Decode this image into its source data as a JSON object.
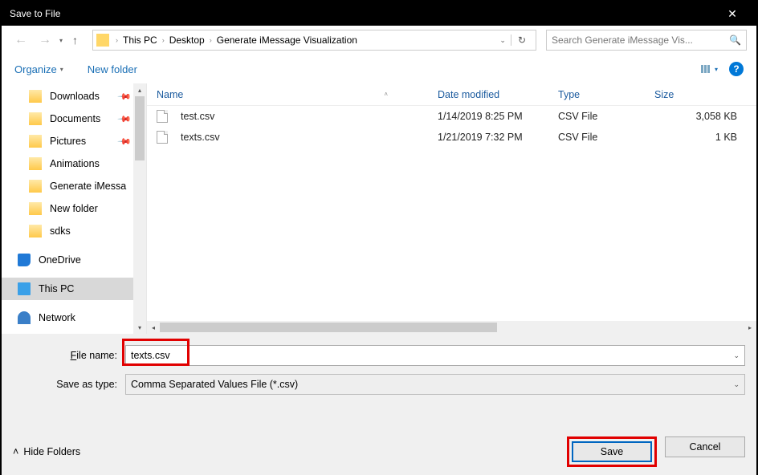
{
  "window": {
    "title": "Save to File"
  },
  "breadcrumbs": {
    "root": "This PC",
    "mid": "Desktop",
    "leaf": "Generate iMessage Visualization"
  },
  "search": {
    "placeholder": "Search Generate iMessage Vis..."
  },
  "toolbar": {
    "organize": "Organize",
    "new_folder": "New folder"
  },
  "sidebar": {
    "items": [
      {
        "label": "Downloads",
        "pinned": true,
        "icon": "folder"
      },
      {
        "label": "Documents",
        "pinned": true,
        "icon": "folder"
      },
      {
        "label": "Pictures",
        "pinned": true,
        "icon": "folder"
      },
      {
        "label": "Animations",
        "icon": "folder"
      },
      {
        "label": "Generate iMessa",
        "icon": "folder"
      },
      {
        "label": "New folder",
        "icon": "folder"
      },
      {
        "label": "sdks",
        "icon": "folder"
      }
    ],
    "onedrive": "OneDrive",
    "thispc": "This PC",
    "network": "Network"
  },
  "columns": {
    "name": "Name",
    "date": "Date modified",
    "type": "Type",
    "size": "Size"
  },
  "files": [
    {
      "name": "test.csv",
      "date": "1/14/2019 8:25 PM",
      "type": "CSV File",
      "size": "3,058 KB"
    },
    {
      "name": "texts.csv",
      "date": "1/21/2019 7:32 PM",
      "type": "CSV File",
      "size": "1 KB"
    }
  ],
  "form": {
    "filename_label": "File name:",
    "filename_value": "texts.csv",
    "savetype_label": "Save as type:",
    "savetype_value": "Comma Separated Values File (*.csv)"
  },
  "footer": {
    "hide_folders": "Hide Folders",
    "save": "Save",
    "cancel": "Cancel"
  }
}
